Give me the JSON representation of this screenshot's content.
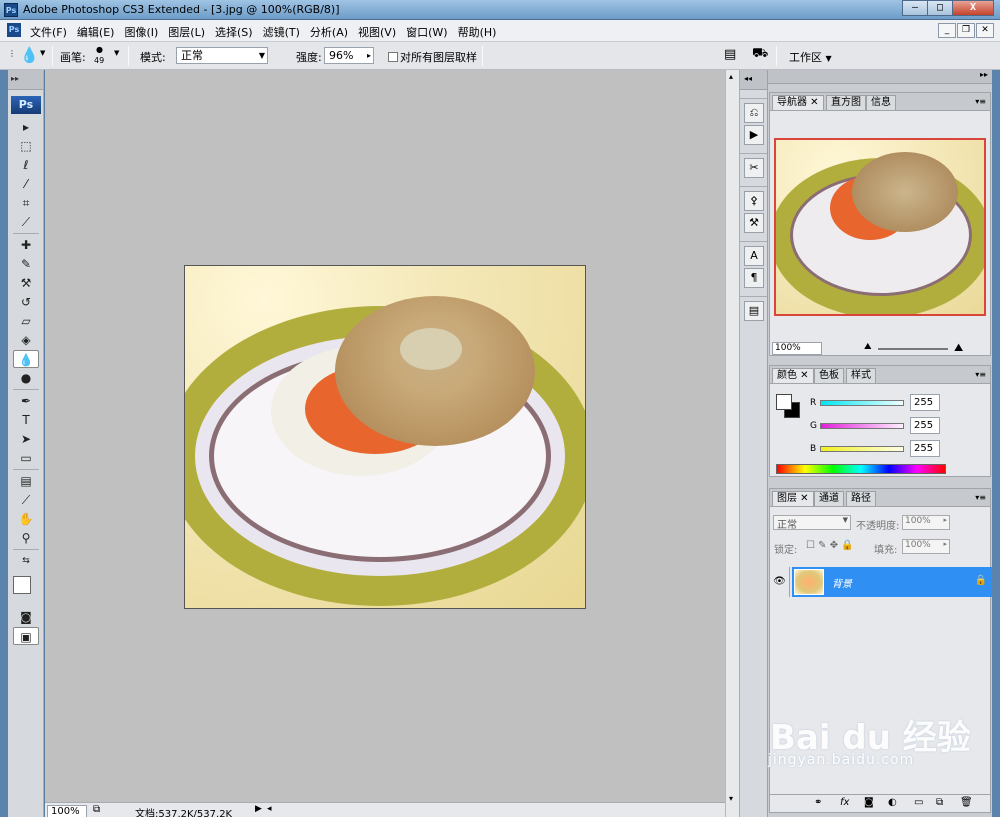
{
  "window": {
    "title": "Adobe Photoshop CS3 Extended - [3.jpg @ 100%(RGB/8)]",
    "app_icon": "Ps",
    "minimize": "—",
    "maximize": "□",
    "close": "X"
  },
  "menu": {
    "items": [
      "文件(F)",
      "编辑(E)",
      "图像(I)",
      "图层(L)",
      "选择(S)",
      "滤镜(T)",
      "分析(A)",
      "视图(V)",
      "窗口(W)",
      "帮助(H)"
    ]
  },
  "options": {
    "brush_label": "画笔:",
    "brush_size": "49",
    "mode_label": "模式:",
    "mode_value": "正常",
    "strength_label": "强度:",
    "strength_value": "96%",
    "sample_all_label": "对所有图层取样",
    "workspace_label": "工作区"
  },
  "toolbox": {
    "logo": "Ps",
    "tools": [
      {
        "name": "move-tool",
        "glyph": "▸"
      },
      {
        "name": "marquee-tool",
        "glyph": "⬚"
      },
      {
        "name": "lasso-tool",
        "glyph": "ℓ"
      },
      {
        "name": "magic-wand-tool",
        "glyph": "⁄"
      },
      {
        "name": "crop-tool",
        "glyph": "⌗"
      },
      {
        "name": "eyedropper-slice-tool",
        "glyph": "⟋"
      },
      {
        "name": "healing-brush-tool",
        "glyph": "✚"
      },
      {
        "name": "brush-tool",
        "glyph": "✎"
      },
      {
        "name": "clone-stamp-tool",
        "glyph": "⚒"
      },
      {
        "name": "history-brush-tool",
        "glyph": "↺"
      },
      {
        "name": "eraser-tool",
        "glyph": "▱"
      },
      {
        "name": "paint-bucket-tool",
        "glyph": "◈"
      },
      {
        "name": "blur-tool",
        "glyph": "💧"
      },
      {
        "name": "dodge-tool",
        "glyph": "●"
      },
      {
        "name": "pen-tool",
        "glyph": "✒"
      },
      {
        "name": "type-tool",
        "glyph": "T"
      },
      {
        "name": "path-selection-tool",
        "glyph": "➤"
      },
      {
        "name": "rectangle-tool",
        "glyph": "▭"
      },
      {
        "name": "notes-tool",
        "glyph": "▤"
      },
      {
        "name": "eyedropper-tool",
        "glyph": "⟋"
      },
      {
        "name": "hand-tool",
        "glyph": "✋"
      },
      {
        "name": "zoom-tool",
        "glyph": "⚲"
      }
    ],
    "active_tool": "blur-tool"
  },
  "status": {
    "zoom": "100%",
    "doc_info": "文档:537.2K/537.2K"
  },
  "navigator": {
    "tabs": [
      "导航器",
      "直方图",
      "信息"
    ],
    "zoom": "100%"
  },
  "color": {
    "tabs": [
      "颜色",
      "色板",
      "样式"
    ],
    "channels": [
      {
        "label": "R",
        "value": "255",
        "color": "#00d8e8"
      },
      {
        "label": "G",
        "value": "255",
        "color": "#e020d8"
      },
      {
        "label": "B",
        "value": "255",
        "color": "#f0f020"
      }
    ]
  },
  "layers": {
    "tabs": [
      "图层",
      "通道",
      "路径"
    ],
    "blend_mode": "正常",
    "opacity_label": "不透明度:",
    "opacity_value": "100%",
    "lock_label": "锁定:",
    "fill_label": "填充:",
    "fill_value": "100%",
    "layer_name": "背景"
  },
  "watermark": {
    "brand": "Bai du 经验",
    "url": "jingyan.baidu.com"
  }
}
